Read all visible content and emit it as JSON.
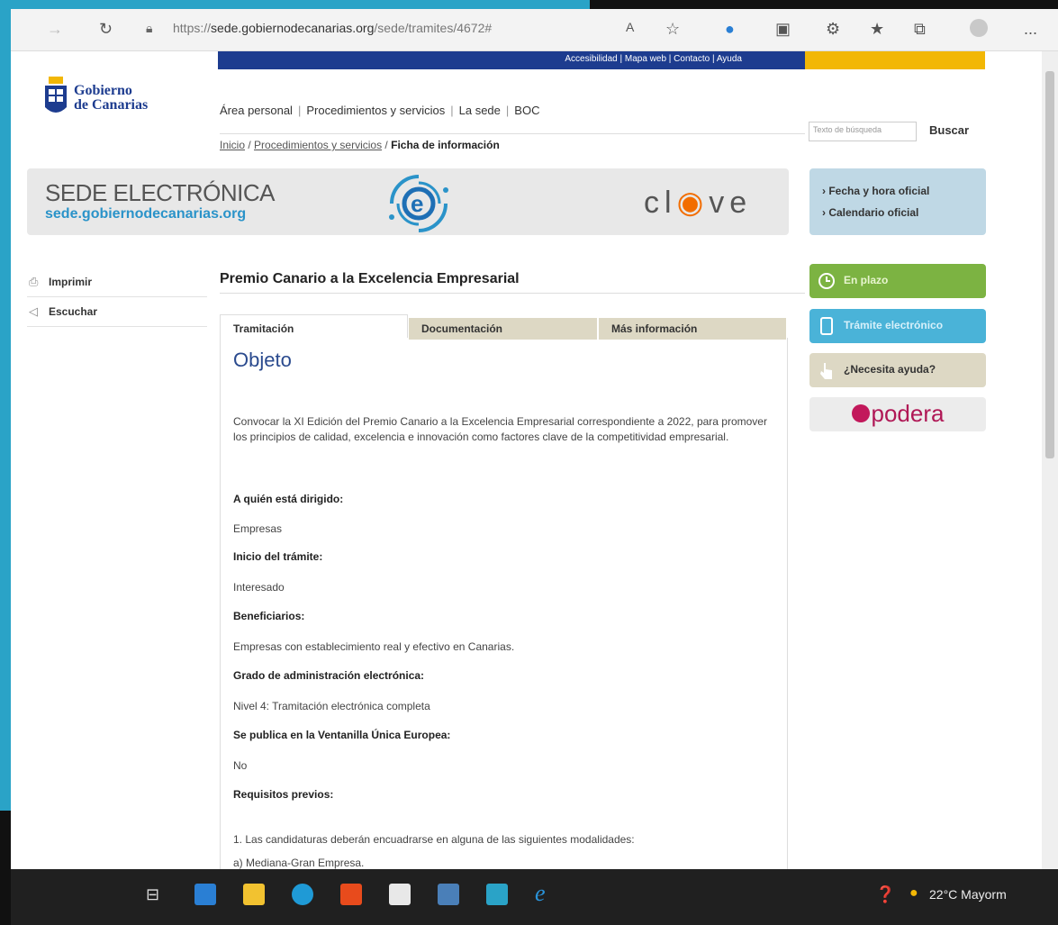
{
  "browser": {
    "url_prefix": "https://",
    "url_host": "sede.gobiernodecanarias.org",
    "url_path": "/sede/tramites/4672#",
    "more_label": "..."
  },
  "header": {
    "top_links": "Accesibilidad | Mapa web | Contacto | Ayuda",
    "logo_line1": "Gobierno",
    "logo_line2": "de Canarias",
    "nav": [
      "Área personal",
      "Procedimientos y servicios",
      "La sede",
      "BOC"
    ],
    "search_placeholder": "Texto de búsqueda",
    "search_button": "Buscar",
    "breadcrumb": [
      "Inicio",
      "Procedimientos y servicios",
      "Ficha de información"
    ]
  },
  "banner": {
    "title": "SEDE ELECTRÓNICA",
    "url": "sede.gobiernodecanarias.org",
    "clave_a": "cl",
    "clave_b": "ve",
    "links": [
      "› Fecha y hora oficial",
      "› Calendario oficial"
    ]
  },
  "left_actions": [
    "Imprimir",
    "Escuchar"
  ],
  "page_title": "Premio Canario a la Excelencia Empresarial",
  "tabs": [
    "Tramitación",
    "Documentación",
    "Más información"
  ],
  "content": {
    "heading": "Objeto",
    "description": "Convocar la XI Edición del Premio Canario a la Excelencia Empresarial correspondiente a 2022, para promover los principios de calidad, excelencia e innovación como factores clave de la competitividad empresarial.",
    "fields": [
      {
        "label": "A quién está dirigido:",
        "value": "Empresas"
      },
      {
        "label": "Inicio del trámite:",
        "value": "Interesado"
      },
      {
        "label": "Beneficiarios:",
        "value": "Empresas con establecimiento real y efectivo en Canarias."
      },
      {
        "label": "Grado de administración electrónica:",
        "value": "Nivel 4: Tramitación electrónica completa"
      },
      {
        "label": "Se publica en la Ventanilla Única Europea:",
        "value": "No"
      },
      {
        "label": "Requisitos previos:",
        "value": ""
      }
    ],
    "requisitos": [
      "1. Las candidaturas deberán encuadrarse en alguna de las siguientes modalidades:",
      "a) Mediana-Gran Empresa."
    ]
  },
  "right_panel": {
    "plazo": "En plazo",
    "tramite": "Trámite electrónico",
    "ayuda": "¿Necesita ayuda?",
    "apodera": "podera"
  },
  "taskbar": {
    "weather": "22°C  Mayorm"
  },
  "colors": {
    "navy": "#1d3c8f",
    "gold": "#f2b705",
    "green": "#7cb342",
    "blue": "#4ab3d8",
    "tan": "#ddd8c4"
  }
}
